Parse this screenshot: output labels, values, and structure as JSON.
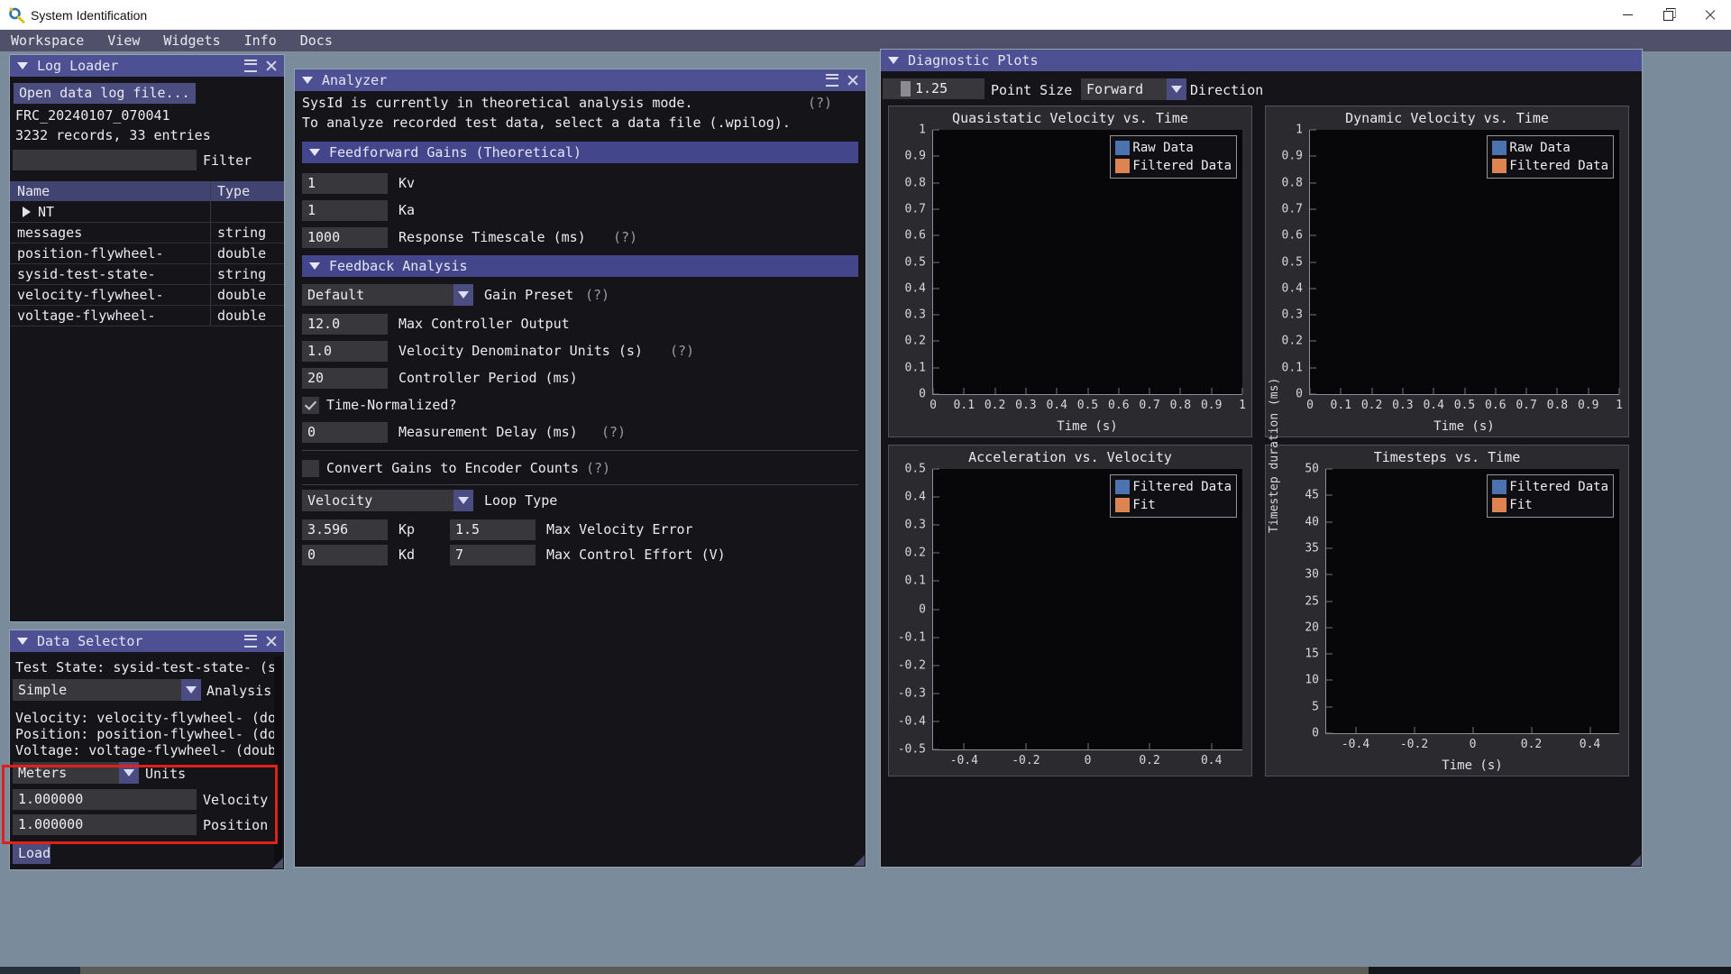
{
  "window": {
    "title": "System Identification"
  },
  "menu": {
    "items": [
      "Workspace",
      "View",
      "Widgets",
      "Info",
      "Docs"
    ]
  },
  "log_loader": {
    "title": "Log Loader",
    "open_button": "Open data log file...",
    "file_name": "FRC_20240107_070041",
    "file_stats": "3232 records, 33 entries",
    "filter_label": "Filter",
    "table": {
      "col_name": "Name",
      "col_type": "Type",
      "rows": [
        {
          "name": "NT",
          "type": ""
        },
        {
          "name": "messages",
          "type": "string"
        },
        {
          "name": "position-flywheel-",
          "type": "double"
        },
        {
          "name": "sysid-test-state-",
          "type": "string"
        },
        {
          "name": "velocity-flywheel-",
          "type": "double"
        },
        {
          "name": "voltage-flywheel-",
          "type": "double"
        }
      ]
    }
  },
  "data_selector": {
    "title": "Data Selector",
    "test_state": "Test State: sysid-test-state- (s",
    "analysis": {
      "value": "Simple",
      "label": "Analysis"
    },
    "velocity_line": "Velocity: velocity-flywheel- (do",
    "position_line": "Position: position-flywheel- (do",
    "voltage_line": "Voltage: voltage-flywheel- (doub",
    "units": {
      "value": "Meters",
      "label": "Units"
    },
    "velocity_field": {
      "value": "1.000000",
      "label": "Velocity"
    },
    "position_field": {
      "value": "1.000000",
      "label": "Position"
    },
    "load_button": "Load"
  },
  "analyzer": {
    "title": "Analyzer",
    "line1": "SysId is currently in theoretical analysis mode.",
    "line1_help": "(?)",
    "line2": "To analyze recorded test data, select a data file (.wpilog).",
    "feedforward": {
      "header": "Feedforward Gains (Theoretical)",
      "kv": {
        "value": "1",
        "label": "Kv"
      },
      "ka": {
        "value": "1",
        "label": "Ka"
      },
      "timescale": {
        "value": "1000",
        "label": "Response Timescale (ms)",
        "help": "(?)"
      }
    },
    "feedback": {
      "header": "Feedback Analysis",
      "preset": {
        "value": "Default",
        "label": "Gain Preset",
        "help": "(?)"
      },
      "max_output": {
        "value": "12.0",
        "label": "Max Controller Output"
      },
      "vel_denom": {
        "value": "1.0",
        "label": "Velocity Denominator Units (s)",
        "help": "(?)"
      },
      "period": {
        "value": "20",
        "label": "Controller Period (ms)"
      },
      "time_normalized": {
        "label": "Time-Normalized?"
      },
      "delay": {
        "value": "0",
        "label": "Measurement Delay (ms)",
        "help": "(?)"
      },
      "convert": {
        "label": "Convert Gains to Encoder Counts",
        "help": "(?)"
      },
      "loop": {
        "value": "Velocity",
        "label": "Loop Type"
      },
      "kp": {
        "value": "3.596",
        "label": "Kp"
      },
      "max_vel_err": {
        "value": "1.5",
        "label": "Max Velocity Error"
      },
      "kd": {
        "value": "0",
        "label": "Kd"
      },
      "max_effort": {
        "value": "7",
        "label": "Max Control Effort (V)"
      }
    }
  },
  "diagnostics": {
    "title": "Diagnostic Plots",
    "point_size": {
      "value": "1.25",
      "label": "Point Size"
    },
    "direction": {
      "value": "Forward",
      "label": "Direction"
    }
  },
  "colors": {
    "series_blue": "#4C72B0",
    "series_orange": "#DD8452",
    "accent_header": "#4E5094",
    "annotation_red": "#E0211B"
  },
  "chart_data": [
    {
      "type": "scatter",
      "title": "Quasistatic Velocity vs. Time",
      "xlabel": "Time (s)",
      "ylabel": "",
      "xlim": [
        0,
        1
      ],
      "ylim": [
        0,
        1
      ],
      "xticks": [
        "0",
        "0.1",
        "0.2",
        "0.3",
        "0.4",
        "0.5",
        "0.6",
        "0.7",
        "0.8",
        "0.9",
        "1"
      ],
      "yticks": [
        "1",
        "0.9",
        "0.8",
        "0.7",
        "0.6",
        "0.5",
        "0.4",
        "0.3",
        "0.2",
        "0.1",
        "0"
      ],
      "grid": false,
      "legend_position": "top-right",
      "legend": [
        {
          "name": "Raw Data",
          "color": "#4C72B0"
        },
        {
          "name": "Filtered Data",
          "color": "#DD8452"
        }
      ],
      "series": [
        {
          "name": "Raw Data",
          "points": []
        },
        {
          "name": "Filtered Data",
          "points": []
        }
      ]
    },
    {
      "type": "scatter",
      "title": "Dynamic Velocity vs. Time",
      "xlabel": "Time (s)",
      "ylabel": "",
      "xlim": [
        0,
        1
      ],
      "ylim": [
        0,
        1
      ],
      "xticks": [
        "0",
        "0.1",
        "0.2",
        "0.3",
        "0.4",
        "0.5",
        "0.6",
        "0.7",
        "0.8",
        "0.9",
        "1"
      ],
      "yticks": [
        "1",
        "0.9",
        "0.8",
        "0.7",
        "0.6",
        "0.5",
        "0.4",
        "0.3",
        "0.2",
        "0.1",
        "0"
      ],
      "grid": false,
      "legend_position": "top-right",
      "legend": [
        {
          "name": "Raw Data",
          "color": "#4C72B0"
        },
        {
          "name": "Filtered Data",
          "color": "#DD8452"
        }
      ],
      "series": [
        {
          "name": "Raw Data",
          "points": []
        },
        {
          "name": "Filtered Data",
          "points": []
        }
      ]
    },
    {
      "type": "scatter",
      "title": "Acceleration vs. Velocity",
      "xlabel": "",
      "ylabel": "",
      "xlim": [
        -0.5,
        0.5
      ],
      "ylim": [
        -0.5,
        0.5
      ],
      "xticks": [
        "-0.4",
        "-0.2",
        "0",
        "0.2",
        "0.4"
      ],
      "yticks": [
        "0.5",
        "0.4",
        "0.3",
        "0.2",
        "0.1",
        "0",
        "-0.1",
        "-0.2",
        "-0.3",
        "-0.4",
        "-0.5"
      ],
      "grid": false,
      "legend_position": "top-right",
      "legend": [
        {
          "name": "Filtered Data",
          "color": "#4C72B0"
        },
        {
          "name": "Fit",
          "color": "#DD8452"
        }
      ],
      "series": [
        {
          "name": "Filtered Data",
          "points": []
        },
        {
          "name": "Fit",
          "points": []
        }
      ]
    },
    {
      "type": "scatter",
      "title": "Timesteps vs. Time",
      "xlabel": "Time (s)",
      "ylabel": "Timestep duration (ms)",
      "xlim": [
        -0.5,
        0.5
      ],
      "ylim": [
        0,
        50
      ],
      "xticks": [
        "-0.4",
        "-0.2",
        "0",
        "0.2",
        "0.4"
      ],
      "yticks": [
        "50",
        "45",
        "40",
        "35",
        "30",
        "25",
        "20",
        "15",
        "10",
        "5",
        "0"
      ],
      "grid": false,
      "legend_position": "top-right",
      "legend": [
        {
          "name": "Filtered Data",
          "color": "#4C72B0"
        },
        {
          "name": "Fit",
          "color": "#DD8452"
        }
      ],
      "series": [
        {
          "name": "Filtered Data",
          "points": []
        },
        {
          "name": "Fit",
          "points": []
        }
      ]
    }
  ]
}
